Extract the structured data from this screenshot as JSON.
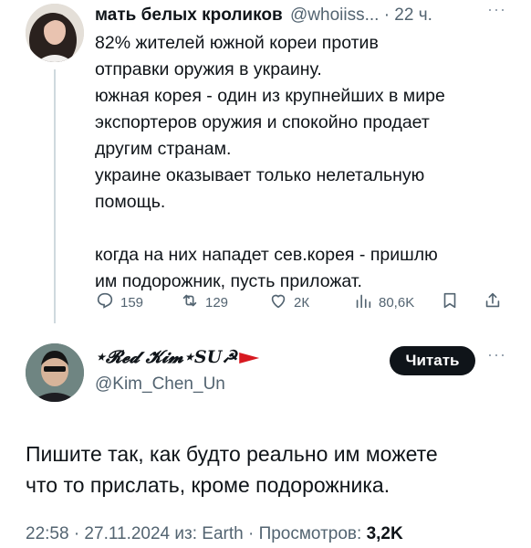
{
  "reply_to": {
    "author_name": "мать белых кроликов",
    "handle": "@whoiiss...",
    "time": "· 22 ч.",
    "more": "···",
    "text": "82% жителей южной кореи против\nотправки оружия в украину.\nюжная корея - один из крупнейших в мире\nэкспортеров оружия и спокойно продает\nдругим странам.\nукраине оказывает только нелетальную\nпомощь.\n\nкогда на них нападет сев.корея - пришлю\nим подорожник, пусть приложат.",
    "actions": {
      "replies": "159",
      "reposts": "129",
      "likes": "2К",
      "views": "80,6K"
    },
    "icons": [
      "reply-icon",
      "repost-icon",
      "like-icon",
      "views-icon",
      "bookmark-icon",
      "share-icon"
    ]
  },
  "tweet": {
    "author_name": "⋆𝓡𝓮𝓭 𝓚𝓲𝓶⋆SU☭",
    "handle": "@Kim_Chen_Un",
    "follow_label": "Читать",
    "more": "···",
    "text": "Пишите так, как будто реально им можете\nчто то прислать, кроме подорожника.",
    "meta_prefix": "22:58 · 27.11.2024 из: Earth · Просмотров: ",
    "views": "3,2K"
  },
  "colors": {
    "text": "#0f1419",
    "secondary": "#536471",
    "thread_line": "#cfd9de",
    "button": "#0f1419"
  }
}
